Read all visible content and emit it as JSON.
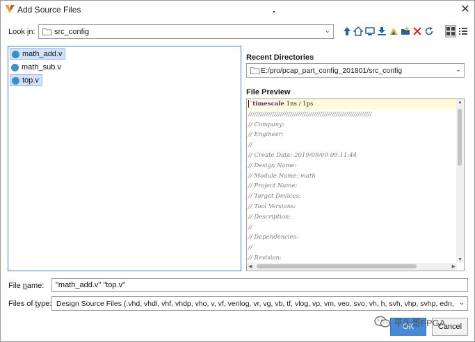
{
  "window": {
    "title": "Add Source Files",
    "close_symbol": "✕"
  },
  "look_in": {
    "label_pre": "Look ",
    "label_mnemonic": "i",
    "label_post": "n:",
    "value": "src_config"
  },
  "toolbar": {
    "buttons": [
      {
        "icon": "up-folder-icon"
      },
      {
        "icon": "home-icon"
      },
      {
        "icon": "desktop-icon"
      },
      {
        "icon": "download-icon"
      },
      {
        "icon": "project-icon"
      },
      {
        "icon": "new-folder-icon"
      },
      {
        "icon": "delete-icon"
      },
      {
        "icon": "refresh-icon"
      },
      {
        "icon": "grid-view-icon"
      },
      {
        "icon": "list-view-icon"
      }
    ]
  },
  "files": [
    {
      "name": "math_add.v",
      "selected": true
    },
    {
      "name": "math_sub.v",
      "selected": false
    },
    {
      "name": "top.v",
      "selected": true
    }
  ],
  "recent": {
    "label": "Recent Directories",
    "value": "E:/pro/pcap_part_config_201801/src_config"
  },
  "preview": {
    "label": "File Preview",
    "first_keyword": "`timescale",
    "first_rest": " 1ns / 1ps",
    "lines": [
      "//////////////////////////////////////////////////////////////",
      "// Company:",
      "// Engineer:",
      "//",
      "// Create Date: 2019/09/09 09:11:44",
      "// Design Name:",
      "// Module Name: math",
      "// Project Name:",
      "// Target Devices:",
      "// Tool Versions:",
      "// Description:",
      "//",
      "// Dependencies:",
      "//",
      "// Revision:"
    ]
  },
  "file_name": {
    "label_pre": "File ",
    "label_mnemonic": "n",
    "label_post": "ame:",
    "value": "\"math_add.v\" \"top.v\""
  },
  "file_type": {
    "label_pre": "Files of ",
    "label_mnemonic": "t",
    "label_post": "ype:",
    "value": "Design Source Files (.vhd, vhdl, vhf, vhdp, vho, v, vf, verilog, vr, vg, vb, tf, vlog, vp, vm, veo, svo, vh, h, svh, vhp, svhp, edn, edf, edif, sv, sv..."
  },
  "buttons": {
    "ok": "OK",
    "cancel": "Cancel"
  },
  "watermark": {
    "text": "平头哥FPGA"
  },
  "colors": {
    "accent": "#4a8ad4",
    "selection": "#cfe2f7",
    "file_icon": "#3a8fc4",
    "delete": "#d62828"
  }
}
